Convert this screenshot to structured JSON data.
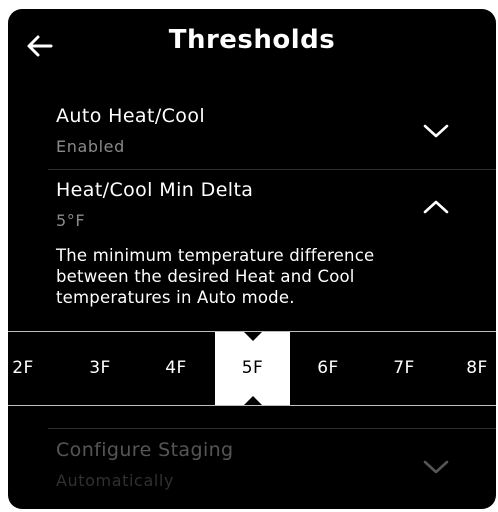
{
  "header": {
    "title": "Thresholds",
    "back_icon": "arrow-left-icon"
  },
  "settings": [
    {
      "title": "Auto Heat/Cool",
      "value": "Enabled",
      "expanded": false
    },
    {
      "title": "Heat/Cool Min Delta",
      "value": "5°F",
      "expanded": true,
      "description": "The minimum temperature difference between the desired Heat and Cool temperatures in Auto mode."
    },
    {
      "title": "Configure Staging",
      "value": "Automatically",
      "expanded": false,
      "faded": true
    }
  ],
  "picker": {
    "options": [
      "2F",
      "3F",
      "4F",
      "5F",
      "6F",
      "7F",
      "8F"
    ],
    "selected": "5F"
  },
  "colors": {
    "background": "#000000",
    "text": "#ffffff",
    "subtext": "#8a8a8a",
    "selected_bg": "#ffffff"
  }
}
